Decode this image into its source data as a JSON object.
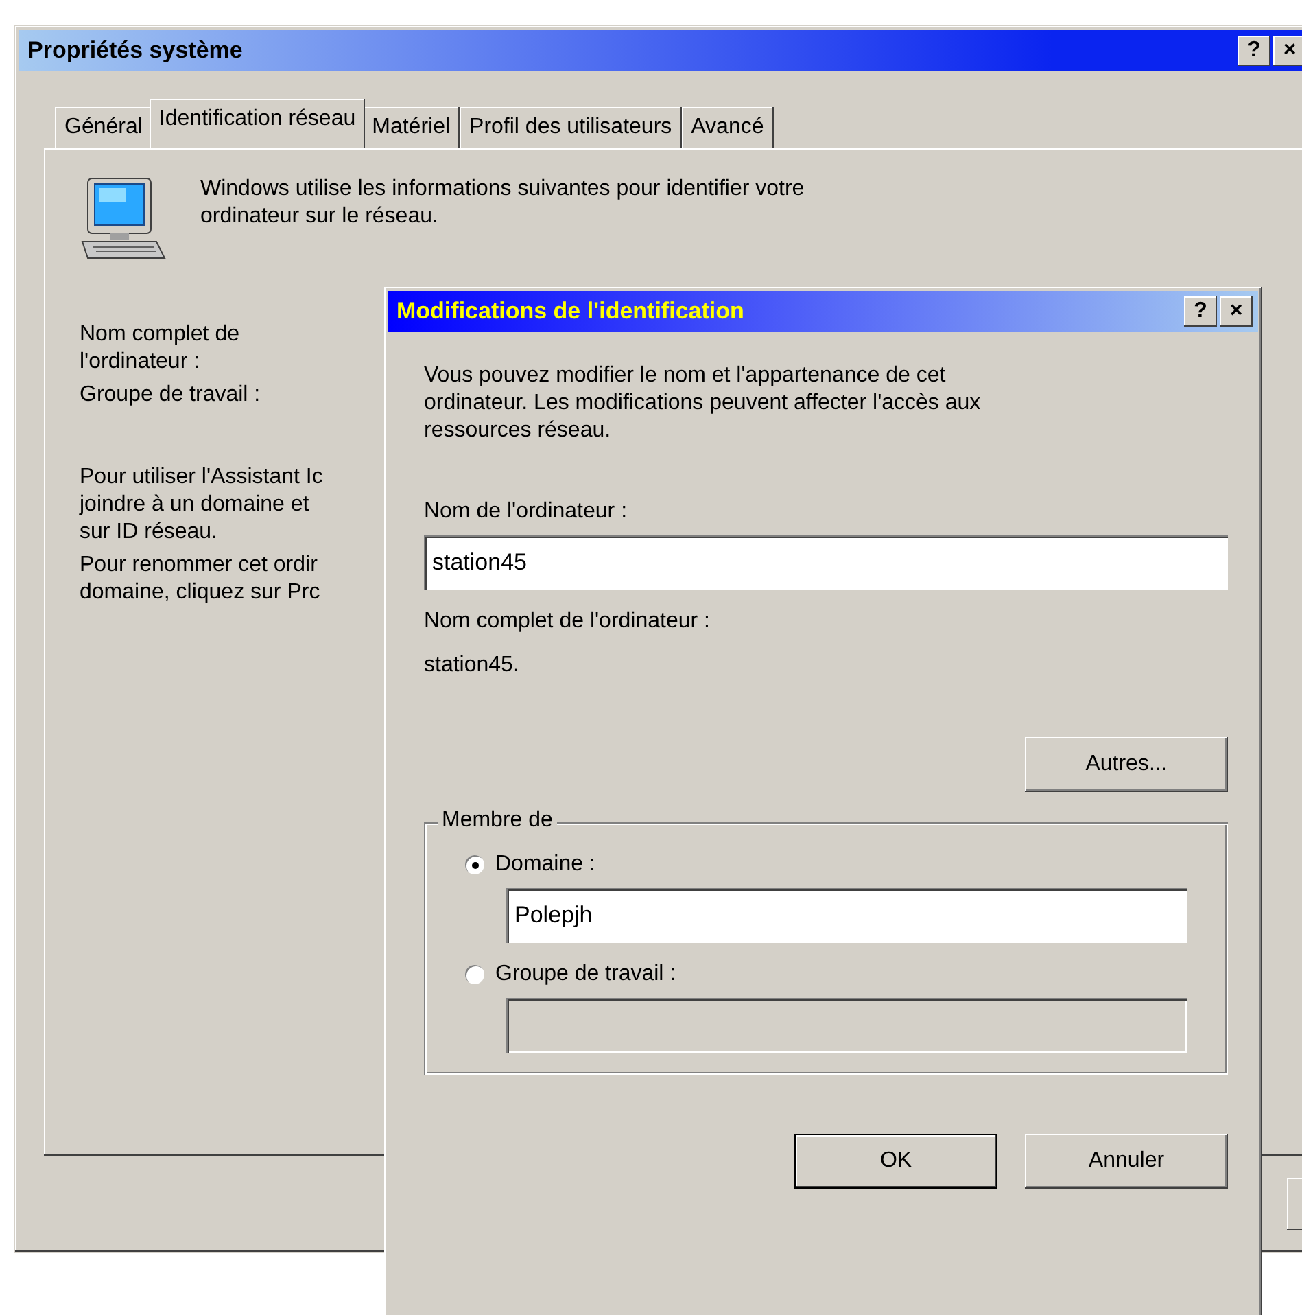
{
  "window": {
    "title": "Propriétés système",
    "title_buttons": [
      "?",
      "×"
    ]
  },
  "tabs": [
    {
      "label": "Général",
      "selected": false
    },
    {
      "label": "Identification réseau",
      "selected": true
    },
    {
      "label": "Matériel",
      "selected": false
    },
    {
      "label": "Profil des utilisateurs",
      "selected": false
    },
    {
      "label": "Avancé",
      "selected": false
    }
  ],
  "panel": {
    "intro": "Windows utilise les informations suivantes pour identifier votre\nordinateur sur le réseau.",
    "labels": [
      "Nom complet de\nl'ordinateur :",
      "Groupe de travail :"
    ],
    "paragraphs": [
      "Pour utiliser l'Assistant Ic\njoindre à un domaine et\nsur ID réseau.",
      "Pour renommer cet ordir\ndomaine, cliquez sur Prc"
    ]
  },
  "dialog": {
    "title": "Modifications de l'identification",
    "title_buttons": [
      "?",
      "×"
    ],
    "description": "Vous pouvez modifier le nom et l'appartenance de cet\nordinateur. Les modifications peuvent affecter l'accès aux\nressources réseau.",
    "computer_name_label": "Nom de l'ordinateur :",
    "computer_name_value": "station45",
    "full_name_label": "Nom complet de l'ordinateur :",
    "full_name_value": "station45.",
    "more_button": "Autres...",
    "member_of": {
      "legend": "Membre de",
      "options": [
        {
          "label": "Domaine :",
          "selected": true,
          "value": "Polepjh",
          "disabled": false
        },
        {
          "label": "Groupe de travail :",
          "selected": false,
          "disabled": true
        }
      ]
    },
    "buttons": [
      {
        "label": "OK",
        "default": true
      },
      {
        "label": "Annuler",
        "default": false
      }
    ]
  }
}
